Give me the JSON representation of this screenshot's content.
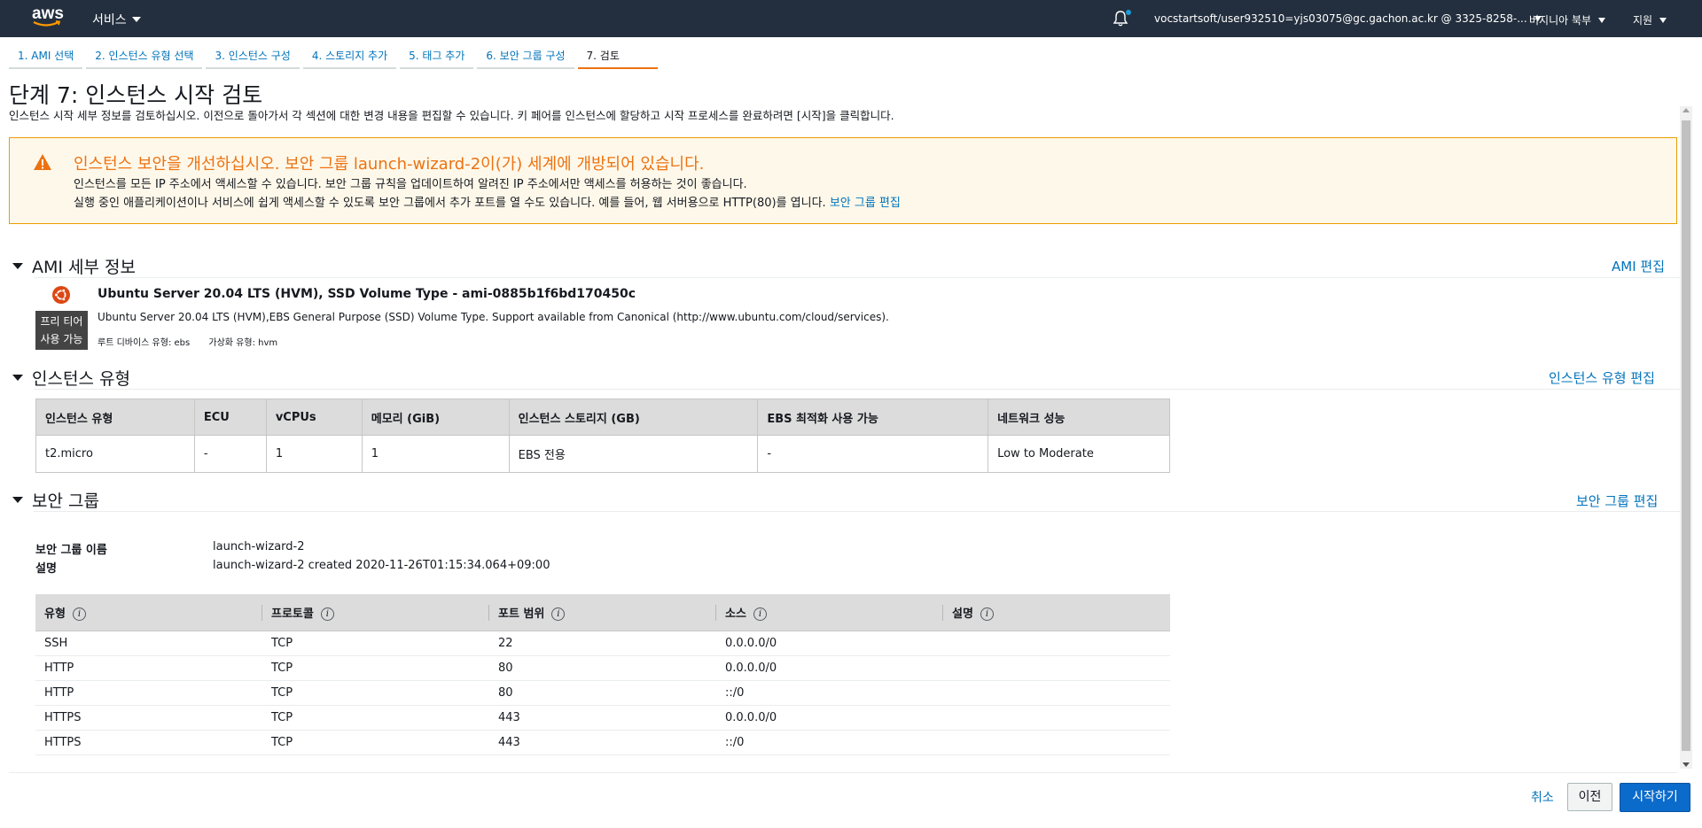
{
  "topnav": {
    "logo_text": "aws",
    "services_label": "서비스",
    "account_label": "vocstartsoft/user932510=yjs03075@gc.gachon.ac.kr @ 3325-8258-...",
    "region_label": "버지니아 북부",
    "support_label": "지원"
  },
  "steps": [
    "1. AMI 선택",
    "2. 인스턴스 유형 선택",
    "3. 인스턴스 구성",
    "4. 스토리지 추가",
    "5. 태그 추가",
    "6. 보안 그룹 구성",
    "7. 검토"
  ],
  "page": {
    "title": "단계 7: 인스턴스 시작 검토",
    "description": "인스턴스 시작 세부 정보를 검토하십시오. 이전으로 돌아가서 각 섹션에 대한 변경 내용을 편집할 수 있습니다. 키 페어를 인스턴스에 할당하고 시작 프로세스를 완료하려면 [시작]을 클릭합니다."
  },
  "warning": {
    "title": "인스턴스 보안을 개선하십시오. 보안 그룹 launch-wizard-2이(가) 세계에 개방되어 있습니다.",
    "line1": "인스턴스를 모든 IP 주소에서 액세스할 수 있습니다. 보안 그룹 규칙을 업데이트하여 알려진 IP 주소에서만 액세스를 허용하는 것이 좋습니다.",
    "line2": "실행 중인 애플리케이션이나 서비스에 쉽게 액세스할 수 있도록 보안 그룹에서 추가 포트를 열 수도 있습니다. 예를 들어, 웹 서버용으로 HTTP(80)를 엽니다.",
    "link": "보안 그룹 편집",
    "color": "#ec7211"
  },
  "ami": {
    "section_title": "AMI 세부 정보",
    "edit_link": "AMI 편집",
    "name": "Ubuntu Server 20.04 LTS (HVM), SSD Volume Type - ami-0885b1f6bd170450c",
    "description": "Ubuntu Server 20.04 LTS (HVM),EBS General Purpose (SSD) Volume Type. Support available from Canonical (http://www.ubuntu.com/cloud/services).",
    "free_tier_line1": "프리 티어",
    "free_tier_line2": "사용 가능",
    "root_device": "루트 디바이스 유형: ebs",
    "virtualization": "가상화 유형: hvm",
    "icon": "ubuntu-icon"
  },
  "instance": {
    "section_title": "인스턴스 유형",
    "edit_link": "인스턴스 유형 편집",
    "headers": [
      "인스턴스 유형",
      "ECU",
      "vCPUs",
      "메모리 (GiB)",
      "인스턴스 스토리지 (GB)",
      "EBS 최적화 사용 가능",
      "네트워크 성능"
    ],
    "row": [
      "t2.micro",
      "-",
      "1",
      "1",
      "EBS 전용",
      "-",
      "Low to Moderate"
    ]
  },
  "security": {
    "section_title": "보안 그룹",
    "edit_link": "보안 그룹 편집",
    "name_label": "보안 그룹 이름",
    "name_value": "launch-wizard-2",
    "desc_label": "설명",
    "desc_value": "launch-wizard-2 created 2020-11-26T01:15:34.064+09:00",
    "headers": [
      "유형",
      "프로토콜",
      "포트 범위",
      "소스",
      "설명"
    ],
    "info_glyph": "i",
    "rules": [
      [
        "SSH",
        "TCP",
        "22",
        "0.0.0.0/0",
        ""
      ],
      [
        "HTTP",
        "TCP",
        "80",
        "0.0.0.0/0",
        ""
      ],
      [
        "HTTP",
        "TCP",
        "80",
        "::/0",
        ""
      ],
      [
        "HTTPS",
        "TCP",
        "443",
        "0.0.0.0/0",
        ""
      ],
      [
        "HTTPS",
        "TCP",
        "443",
        "::/0",
        ""
      ]
    ]
  },
  "footer": {
    "cancel": "취소",
    "previous": "이전",
    "launch": "시작하기",
    "launch_color": "#0b6bcb"
  }
}
